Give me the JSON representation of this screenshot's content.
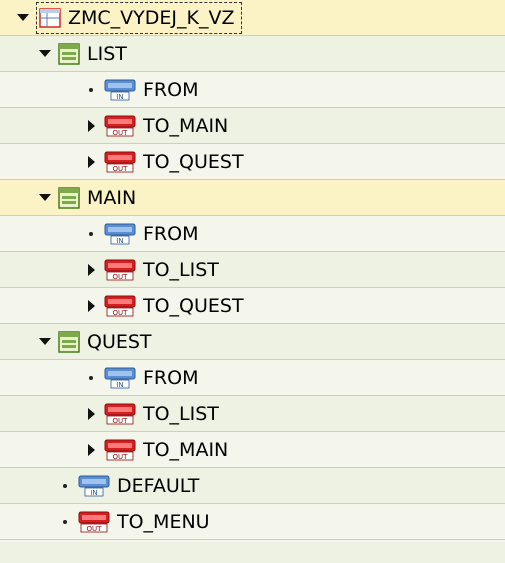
{
  "tree": {
    "root": {
      "label": "ZMC_VYDEJ_K_VZ",
      "icon": "table-icon"
    },
    "list": {
      "label": "LIST",
      "from": "FROM",
      "to_main": "TO_MAIN",
      "to_quest": "TO_QUEST"
    },
    "main": {
      "label": "MAIN",
      "from": "FROM",
      "to_list": "TO_LIST",
      "to_quest": "TO_QUEST"
    },
    "quest": {
      "label": "QUEST",
      "from": "FROM",
      "to_list": "TO_LIST",
      "to_main": "TO_MAIN"
    },
    "default": "DEFAULT",
    "to_menu": "TO_MENU"
  },
  "icons": {
    "in_badge": "IN",
    "out_badge": "OUT"
  },
  "colors": {
    "background": "#f4f6ec",
    "highlight": "#fbf3c6",
    "inbound_plug": "#4a7fc0",
    "outbound_plug": "#cc1b1b",
    "view_icon": "#7fa84a"
  }
}
